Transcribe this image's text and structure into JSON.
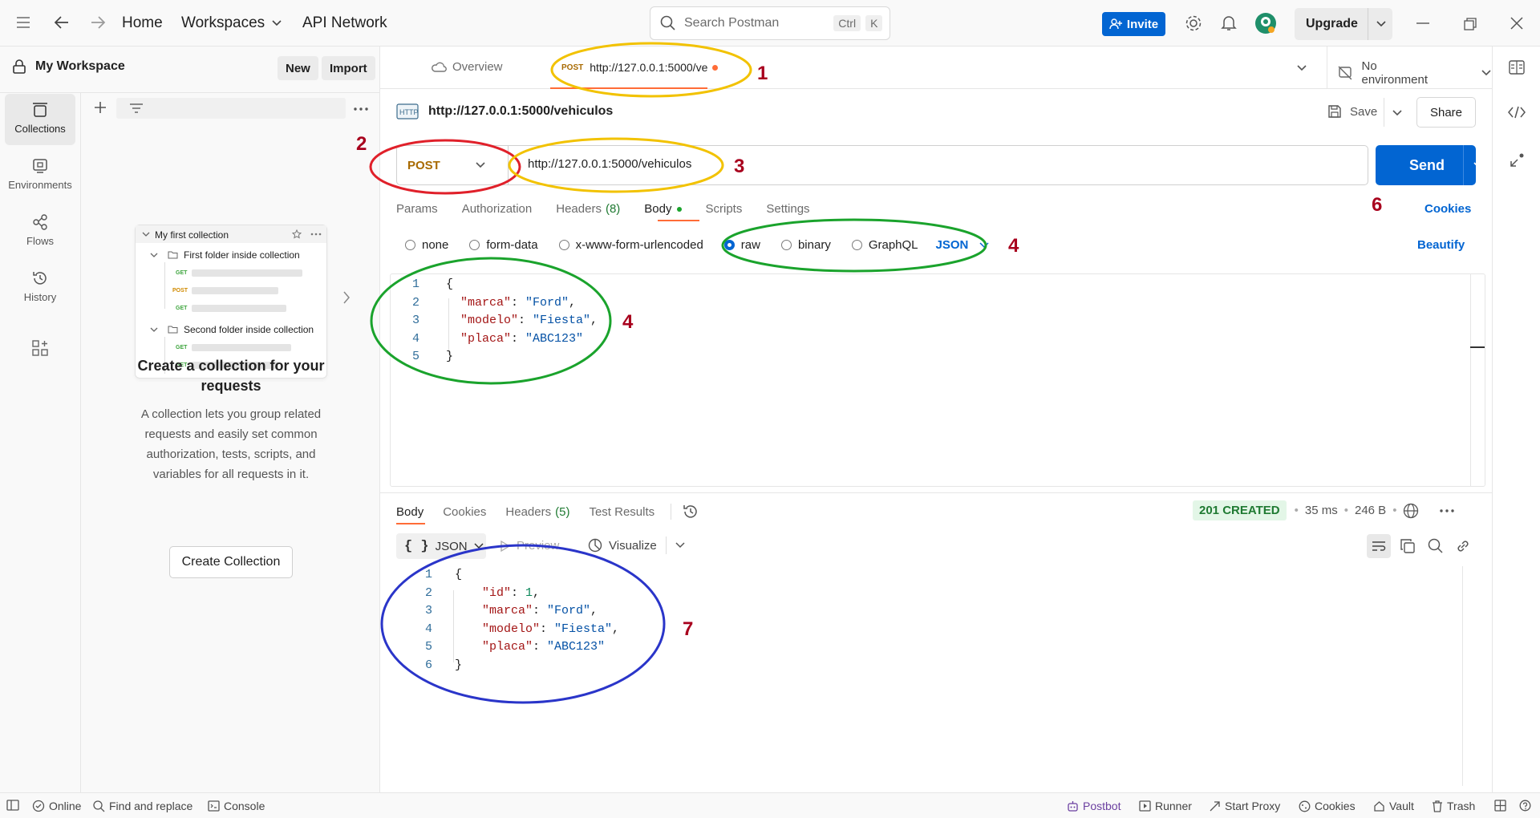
{
  "topbar": {
    "home": "Home",
    "workspaces": "Workspaces",
    "api_network": "API Network",
    "search_placeholder": "Search Postman",
    "shortcut_ctrl": "Ctrl",
    "shortcut_k": "K",
    "invite": "Invite",
    "upgrade": "Upgrade"
  },
  "sidebar": {
    "workspace_name": "My Workspace",
    "new_label": "New",
    "import_label": "Import",
    "rail": [
      {
        "label": "Collections",
        "icon": "collections-icon"
      },
      {
        "label": "Environments",
        "icon": "environments-icon"
      },
      {
        "label": "Flows",
        "icon": "flows-icon"
      },
      {
        "label": "History",
        "icon": "history-icon"
      }
    ],
    "card": {
      "collection": "My first collection",
      "folder1": "First folder inside collection",
      "folder2": "Second folder inside collection",
      "get": "GET",
      "post": "POST"
    },
    "empty_title": "Create a collection for your requests",
    "empty_body": "A collection lets you group related requests and easily set common authorization, tests, scripts, and variables for all requests in it.",
    "create_button": "Create Collection"
  },
  "tabs": {
    "overview": "Overview",
    "active_method": "POST",
    "active_url": "http://127.0.0.1:5000/ve",
    "environment": "No environment"
  },
  "request": {
    "title": "http://127.0.0.1:5000/vehiculos",
    "save": "Save",
    "share": "Share",
    "method": "POST",
    "url": "http://127.0.0.1:5000/vehiculos",
    "send": "Send",
    "subtabs": [
      {
        "label": "Params"
      },
      {
        "label": "Authorization"
      },
      {
        "label": "Headers",
        "count": "(8)"
      },
      {
        "label": "Body"
      },
      {
        "label": "Scripts"
      },
      {
        "label": "Settings"
      }
    ],
    "cookies": "Cookies",
    "body_types": [
      "none",
      "form-data",
      "x-www-form-urlencoded",
      "raw",
      "binary",
      "GraphQL"
    ],
    "selected_body_type": "raw",
    "format": "JSON",
    "beautify": "Beautify",
    "body_lines": [
      {
        "n": "1",
        "text": "{"
      },
      {
        "n": "2",
        "key": "\"marca\"",
        "val": "\"Ford\"",
        "tail": ","
      },
      {
        "n": "3",
        "key": "\"modelo\"",
        "val": "\"Fiesta\"",
        "tail": ","
      },
      {
        "n": "4",
        "key": "\"placa\"",
        "val": "\"ABC123\"",
        "tail": ""
      },
      {
        "n": "5",
        "text": "}"
      }
    ]
  },
  "response": {
    "tabs": [
      {
        "label": "Body"
      },
      {
        "label": "Cookies"
      },
      {
        "label": "Headers",
        "count": "(5)"
      },
      {
        "label": "Test Results"
      }
    ],
    "status": "201 CREATED",
    "time": "35 ms",
    "size": "246 B",
    "format": "JSON",
    "preview": "Preview",
    "visualize": "Visualize",
    "lines": [
      {
        "n": "1",
        "text": "{"
      },
      {
        "n": "2",
        "key": "\"id\"",
        "num": "1",
        "tail": ","
      },
      {
        "n": "3",
        "key": "\"marca\"",
        "val": "\"Ford\"",
        "tail": ","
      },
      {
        "n": "4",
        "key": "\"modelo\"",
        "val": "\"Fiesta\"",
        "tail": ","
      },
      {
        "n": "5",
        "key": "\"placa\"",
        "val": "\"ABC123\"",
        "tail": ""
      },
      {
        "n": "6",
        "text": "}"
      }
    ]
  },
  "annotations": [
    "1",
    "2",
    "3",
    "4",
    "4",
    "6",
    "7"
  ],
  "statusbar": {
    "online": "Online",
    "find_replace": "Find and replace",
    "console": "Console",
    "postbot": "Postbot",
    "runner": "Runner",
    "start_proxy": "Start Proxy",
    "cookies": "Cookies",
    "vault": "Vault",
    "trash": "Trash"
  },
  "colors": {
    "accent": "#0265d2",
    "post_method": "#a86a00",
    "status_ok_bg": "#e3f6e7",
    "status_ok_text": "#1f7a32",
    "annotation_red": "#a8001d",
    "highlight_yellow": "#f2c200",
    "highlight_red": "#e0202a",
    "highlight_green": "#1aa32c",
    "highlight_blue": "#2a35c9"
  }
}
